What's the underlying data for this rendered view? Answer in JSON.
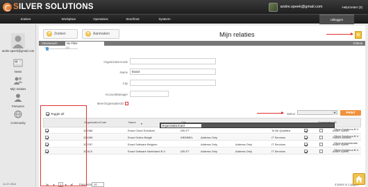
{
  "app": {
    "logo_silver": "S",
    "logo_rest": "ILVER SOLUTIONS",
    "user_email": "andre.speek@gmail.com",
    "helpcenter": "HelpCenter (3)"
  },
  "nav": {
    "tabs": [
      {
        "label": "Zoeken",
        "active": false
      },
      {
        "label": "Workplace",
        "active": false
      },
      {
        "label": "Operations",
        "active": false
      },
      {
        "label": "Storefront",
        "active": false
      },
      {
        "label": "Systeem",
        "active": false
      },
      {
        "label": "Uitloggen",
        "active": true
      }
    ]
  },
  "sidebar": {
    "email": "andre.speek@gmail.com",
    "items": [
      {
        "label": "News",
        "icon": "newspaper-icon"
      },
      {
        "label": "Mijn relaties",
        "icon": "people-icon"
      },
      {
        "label": "Personen",
        "icon": "person-icon"
      },
      {
        "label": "Community",
        "icon": "globe-icon"
      }
    ],
    "date": "11-07-2014"
  },
  "toolbar": {
    "search_label": "Zoeken",
    "add_label": "Aanmaken",
    "title": "Mijn relaties"
  },
  "searchbar": {
    "label": "Clearsearch",
    "filter": "No Filter",
    "criteria": "Criteria",
    "slider_left": "0",
    "slider_right": "100"
  },
  "form": {
    "fields": [
      {
        "label": "OrganizationCode",
        "value": ""
      },
      {
        "label": "Name",
        "value": "Exact"
      },
      {
        "label": "City",
        "value": ""
      },
      {
        "label": "AccountManager",
        "value": ""
      },
      {
        "label": "MeerOrganisatiesID",
        "value": ""
      }
    ]
  },
  "toggle_all": "Toggle all",
  "select": {
    "label": "Select",
    "print": "PRINT",
    "option": "OrganizationCard"
  },
  "grid": {
    "columns": [
      "",
      "OrganizationCode",
      "Name",
      "City",
      "",
      "",
      "",
      "",
      "",
      "",
      "",
      "",
      "OrganizationID"
    ],
    "rows": [
      {
        "checked": true,
        "code": "101086",
        "name": "Exact Cloud Solutions",
        "city": "DELFT",
        "addr1": "",
        "addr2": "",
        "status": "To Be Qualified",
        "cb1": true,
        "cb2": false,
        "manager": "Andre Speek",
        "org": "Silver Solutions B.V."
      },
      {
        "checked": true,
        "code": "101085",
        "name": "Exact Online België",
        "city": "WEMMEL",
        "addr1": "Address Only",
        "addr2": "",
        "status": "IT Services",
        "cb1": true,
        "cb2": false,
        "manager": "Robert Browne",
        "org": "Silver Solutions B.V."
      },
      {
        "checked": true,
        "code": "100787",
        "name": "Exact Software Belgium",
        "city": "",
        "addr1": "Address Only",
        "addr2": "Address Only",
        "status": "IT Services",
        "cb1": true,
        "cb2": false,
        "manager": "Andre Speek",
        "org": "Silver Administratie"
      },
      {
        "checked": true,
        "code": "100110",
        "name": "Exact Software Nederland B.V.",
        "city": "DELFT",
        "addr1": "Address Only",
        "addr2": "Address Only",
        "status": "IT Services",
        "cb1": true,
        "cb2": false,
        "manager": "Andre Speek",
        "org": "Silver Solutions B.V."
      }
    ],
    "pager": {
      "page": "1",
      "page_size_label": "Page size:",
      "page_size": "10",
      "items_info": "4 items in 1 pages"
    }
  }
}
